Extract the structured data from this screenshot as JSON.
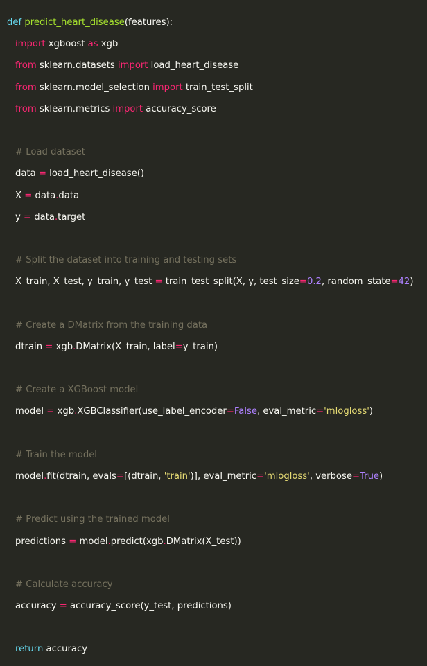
{
  "editor": {
    "colors": {
      "background": "#272822",
      "text": "#f8f8f2",
      "keyword": "#66d9ef",
      "import_keyword": "#f92672",
      "function_name": "#a6e22e",
      "operator": "#f92672",
      "number": "#ae81ff",
      "string": "#e6db74",
      "comment": "#75715e"
    },
    "lines": {
      "l1": {
        "def": "def",
        "name": "predict_heart_disease",
        "rest": "(features):"
      },
      "l2": {
        "import": "import",
        "mod": " xgboost ",
        "as": "as",
        "alias": " xgb"
      },
      "l3": {
        "from": "from",
        "mod": " sklearn.datasets ",
        "import": "import",
        "what": " load_heart_disease"
      },
      "l4": {
        "from": "from",
        "mod": " sklearn.model_selection ",
        "import": "import",
        "what": " train_test_split"
      },
      "l5": {
        "from": "from",
        "mod": " sklearn.metrics ",
        "import": "import",
        "what": " accuracy_score"
      },
      "l7": {
        "comment": "# Load dataset"
      },
      "l8": {
        "a": "data ",
        "op": "=",
        "b": " load_heart_disease()"
      },
      "l9": {
        "a": "X ",
        "op": "=",
        "b": " data",
        "dot": ".",
        "c": "data"
      },
      "l10": {
        "a": "y ",
        "op": "=",
        "b": " data",
        "dot": ".",
        "c": "target"
      },
      "l12": {
        "comment": "# Split the dataset into training and testing sets"
      },
      "l13": {
        "a": "X_train, X_test, y_train, y_test ",
        "op": "=",
        "b": " train_test_split(X, y, test_size",
        "op2": "=",
        "n1": "0.2",
        "c": ", random_state",
        "op3": "=",
        "n2": "42",
        "d": ")"
      },
      "l15": {
        "comment": "# Create a DMatrix from the training data"
      },
      "l16": {
        "a": "dtrain ",
        "op": "=",
        "b": " xgb",
        "dot": ".",
        "c": "DMatrix(X_train, label",
        "op2": "=",
        "d": "y_train)"
      },
      "l18": {
        "comment": "# Create a XGBoost model"
      },
      "l19": {
        "a": "model ",
        "op": "=",
        "b": " xgb",
        "dot": ".",
        "c": "XGBClassifier(use_label_encoder",
        "op2": "=",
        "kw": "False",
        "d": ", eval_metric",
        "op3": "=",
        "s": "'mlogloss'",
        "e": ")"
      },
      "l21": {
        "comment": "# Train the model"
      },
      "l22": {
        "a": "model",
        "dot": ".",
        "b": "fit(dtrain, evals",
        "op": "=",
        "c": "[(dtrain, ",
        "s1": "'train'",
        "d": ")], eval_metric",
        "op2": "=",
        "s2": "'mlogloss'",
        "e": ", verbose",
        "op3": "=",
        "kw": "True",
        "f": ")"
      },
      "l24": {
        "comment": "# Predict using the trained model"
      },
      "l25": {
        "a": "predictions ",
        "op": "=",
        "b": " model",
        "dot": ".",
        "c": "predict(xgb",
        "dot2": ".",
        "d": "DMatrix(X_test))"
      },
      "l27": {
        "comment": "# Calculate accuracy"
      },
      "l28": {
        "a": "accuracy ",
        "op": "=",
        "b": " accuracy_score(y_test, predictions)"
      },
      "l30": {
        "ret": "return",
        "b": " accuracy"
      }
    }
  }
}
